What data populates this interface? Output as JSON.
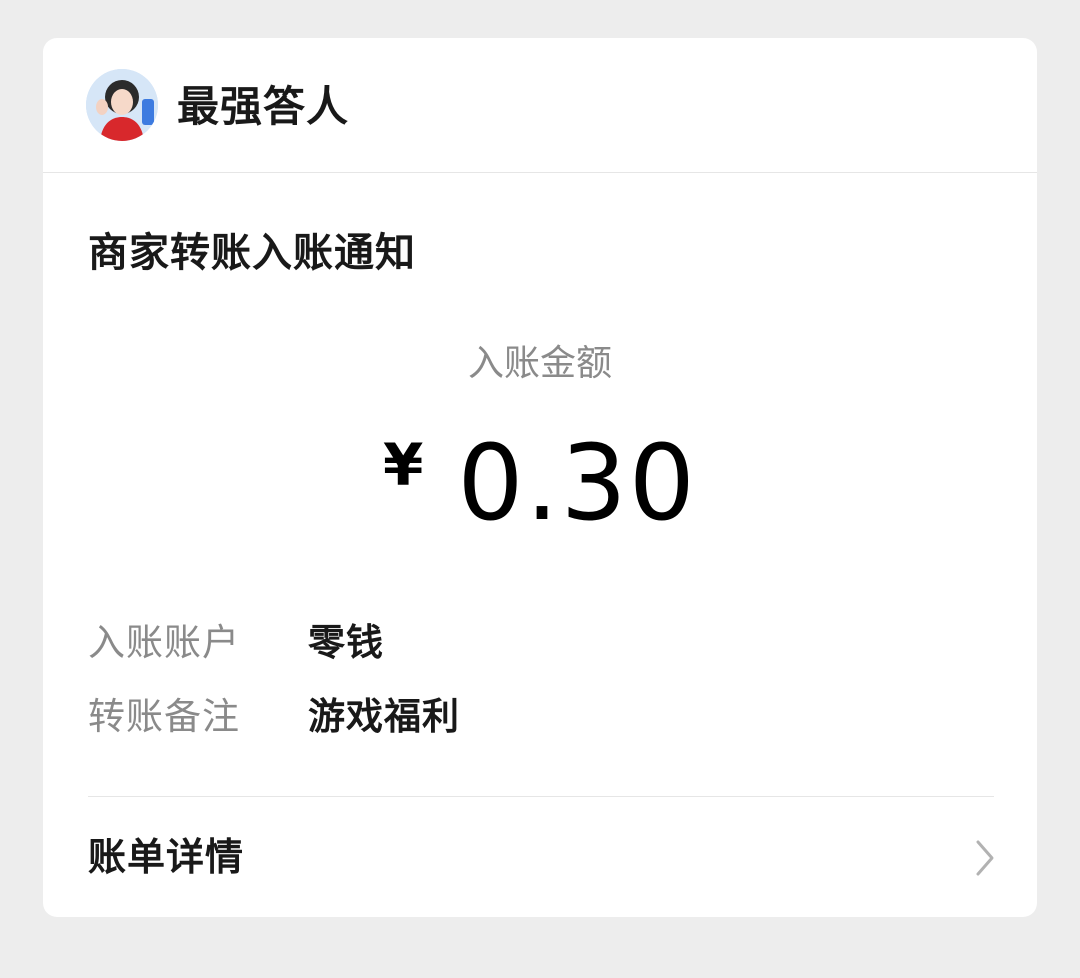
{
  "merchant": {
    "name": "最强答人",
    "avatar_icon": "avatar-icon"
  },
  "notice": {
    "title": "商家转账入账通知"
  },
  "amount": {
    "label": "入账金额",
    "currency": "¥",
    "value": "0.30"
  },
  "details": [
    {
      "label": "入账账户",
      "value": "零钱"
    },
    {
      "label": "转账备注",
      "value": "游戏福利"
    }
  ],
  "bill_detail": {
    "label": "账单详情",
    "icon": "chevron-right-icon"
  },
  "colors": {
    "background": "#ededed",
    "card": "#ffffff",
    "primary_text": "#191919",
    "secondary_text": "#8a8a8a",
    "divider": "#e6e6e6"
  }
}
